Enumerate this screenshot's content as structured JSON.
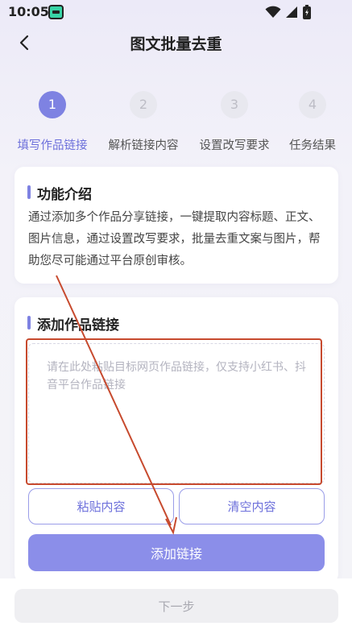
{
  "status_bar": {
    "time": "10:05",
    "icons": [
      "app-badge-icon",
      "wifi-icon",
      "signal-icon",
      "battery-icon"
    ]
  },
  "header": {
    "title": "图文批量去重",
    "back_icon": "chevron-left-icon"
  },
  "steps": [
    {
      "number": "1",
      "label": "填写作品链接",
      "active": true
    },
    {
      "number": "2",
      "label": "解析链接内容",
      "active": false
    },
    {
      "number": "3",
      "label": "设置改写要求",
      "active": false
    },
    {
      "number": "4",
      "label": "任务结果",
      "active": false
    }
  ],
  "intro_card": {
    "title": "功能介绍",
    "text": "通过添加多个作品分享链接，一键提取内容标题、正文、图片信息，通过设置改写要求，批量去重文案与图片，帮助您尽可能通过平台原创审核。"
  },
  "link_card": {
    "title": "添加作品链接",
    "input_value": "",
    "input_placeholder": "请在此处粘贴目标网页作品链接，仅支持小红书、抖音平台作品链接",
    "paste_label": "粘贴内容",
    "clear_label": "清空内容",
    "add_label": "添加链接"
  },
  "footer": {
    "next_label": "下一步"
  },
  "colors": {
    "accent": "#7e82e2",
    "accent_button": "#8b8ee9",
    "annotation": "#c74a2e",
    "disabled_button": "#efeff2"
  }
}
